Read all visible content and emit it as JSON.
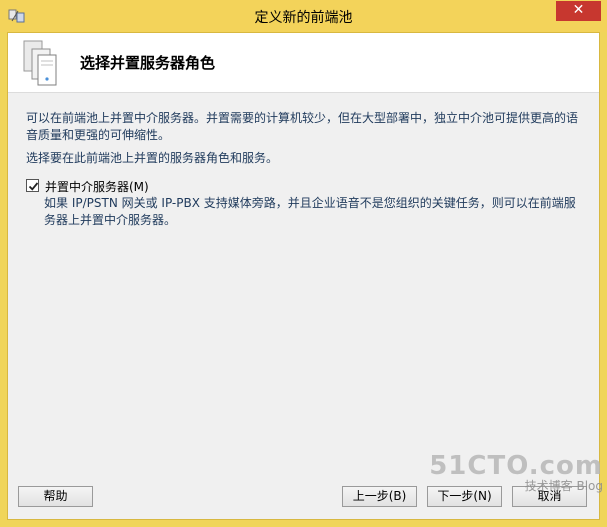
{
  "window": {
    "title": "定义新的前端池",
    "close_glyph": "✕"
  },
  "header": {
    "title": "选择并置服务器角色",
    "icon": "server-stack-icon"
  },
  "content": {
    "intro": "可以在前端池上并置中介服务器。并置需要的计算机较少，但在大型部署中，独立中介池可提供更高的语音质量和更强的可伸缩性。",
    "instruction": "选择要在此前端池上并置的服务器角色和服务。",
    "option": {
      "label": "并置中介服务器(M)",
      "checked": true,
      "description": "如果 IP/PSTN 网关或 IP-PBX 支持媒体旁路，并且企业语音不是您组织的关键任务，则可以在前端服务器上并置中介服务器。"
    }
  },
  "buttons": {
    "help": "帮助",
    "prev": "上一步(B)",
    "next": "下一步(N)",
    "cancel": "取消"
  },
  "watermark": {
    "line1": "51CTO.com",
    "line2": "技术博客 Blog"
  },
  "colors": {
    "titlebar": "#f3d35a",
    "close": "#c7372f",
    "text": "#1e395b"
  }
}
